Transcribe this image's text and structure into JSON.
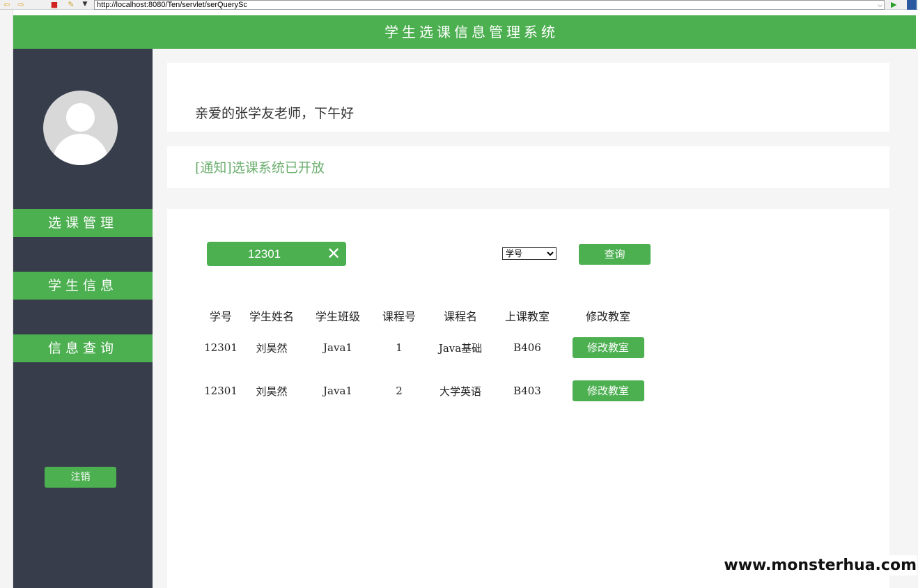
{
  "browser": {
    "address": "http://localhost:8080/Ten/servlet/serQuerySc"
  },
  "header": {
    "title": "学生选课信息管理系统"
  },
  "sidebar": {
    "menu": [
      {
        "label": "选课管理"
      },
      {
        "label": "学生信息"
      },
      {
        "label": "信息查询"
      }
    ],
    "logout_label": "注销"
  },
  "greeting": {
    "text": "亲爱的张学友老师，下午好"
  },
  "notice": {
    "text": "[通知]选课系统已开放"
  },
  "query": {
    "search_value": "12301",
    "field_selected": "学号",
    "button_label": "查询"
  },
  "table": {
    "headers": [
      "学号",
      "学生姓名",
      "学生班级",
      "课程号",
      "课程名",
      "上课教室",
      "修改教室"
    ],
    "rows": [
      {
        "student_id": "12301",
        "name": "刘昊然",
        "class": "Java1",
        "course_no": "1",
        "course_name": "Java基础",
        "room": "B406",
        "action": "修改教室"
      },
      {
        "student_id": "12301",
        "name": "刘昊然",
        "class": "Java1",
        "course_no": "2",
        "course_name": "大学英语",
        "room": "B403",
        "action": "修改教室"
      }
    ]
  },
  "watermark": {
    "text": "www.monsterhua.com"
  },
  "icons": {
    "back": "back-arrow-icon",
    "forward": "forward-arrow-icon",
    "stop": "stop-icon",
    "tools": "tools-icon",
    "clear": "close-icon",
    "go": "go-play-icon"
  },
  "colors": {
    "accent": "#4caf50",
    "sidebar": "#373d4b",
    "notice": "#6aae6d"
  }
}
